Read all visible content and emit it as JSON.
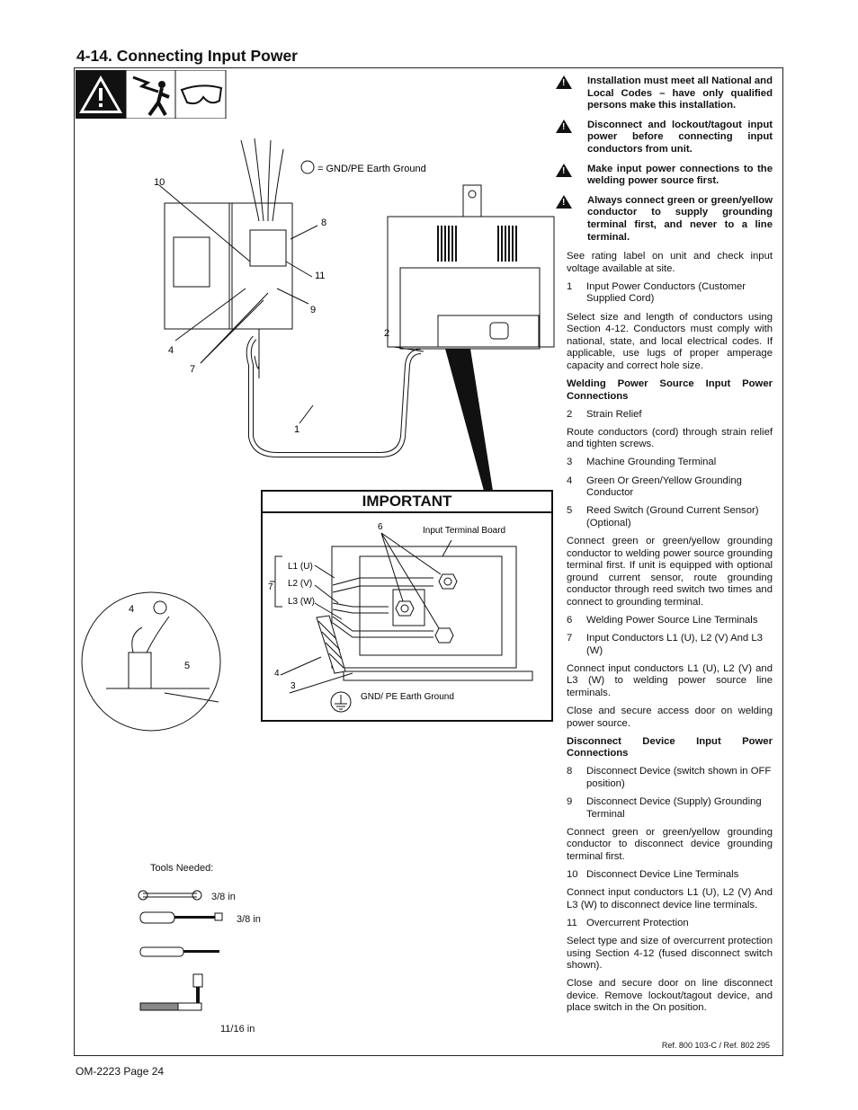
{
  "title": "4-14. Connecting Input Power",
  "footer": "OM-2223 Page 24",
  "reference": "Ref. 800 103-C / Ref. 802 295",
  "safety_icons": [
    "warning-icon",
    "electric-shock-icon",
    "safety-glasses-icon"
  ],
  "warnings": [
    "Installation must meet all National and Local Codes – have only qualified persons make this installation.",
    "Disconnect and lockout/tagout input power before connecting input conductors from unit.",
    "Make input power connections to the welding power source first.",
    "Always connect green or green/yellow conductor to supply grounding terminal first, and never to a line terminal."
  ],
  "body": {
    "p1": "See rating label on unit and check input voltage available at site.",
    "i1": {
      "n": "1",
      "t": "Input Power Conductors (Customer Supplied Cord)"
    },
    "p2": "Select size and length of conductors using Section 4-12. Conductors must comply with national, state, and local electrical codes. If applicable, use lugs of proper amperage capacity and correct hole size.",
    "h1": "Welding Power Source Input Power Connections",
    "i2": {
      "n": "2",
      "t": "Strain Relief"
    },
    "p3": "Route conductors (cord) through strain relief and tighten screws.",
    "i3": {
      "n": "3",
      "t": "Machine Grounding Terminal"
    },
    "i4": {
      "n": "4",
      "t": "Green Or Green/Yellow Grounding Conductor"
    },
    "i5": {
      "n": "5",
      "t": "Reed Switch (Ground Current Sensor) (Optional)"
    },
    "p4": "Connect green or green/yellow grounding conductor to welding power source grounding terminal first. If unit is equipped with optional ground current sensor, route grounding conductor through reed switch two times and connect to grounding terminal.",
    "i6": {
      "n": "6",
      "t": "Welding Power Source Line Terminals"
    },
    "i7": {
      "n": "7",
      "t": "Input Conductors L1 (U), L2 (V) And L3 (W)"
    },
    "p5": "Connect input conductors L1 (U), L2 (V) and L3 (W) to welding power source line terminals.",
    "p6": "Close and secure access door on welding power source.",
    "h2": "Disconnect Device Input Power Connections",
    "i8": {
      "n": "8",
      "t": "Disconnect Device (switch shown in OFF position)"
    },
    "i9": {
      "n": "9",
      "t": "Disconnect Device (Supply) Grounding Terminal"
    },
    "p7": "Connect green or green/yellow grounding conductor to disconnect device grounding terminal first.",
    "i10": {
      "n": "10",
      "t": "Disconnect Device Line Terminals"
    },
    "p8": "Connect input conductors L1 (U), L2 (V) And L3 (W) to disconnect device line terminals.",
    "i11": {
      "n": "11",
      "t": "Overcurrent Protection"
    },
    "p9": "Select type and size of overcurrent protection using Section 4-12 (fused disconnect switch shown).",
    "p10": "Close and secure door on line disconnect device. Remove lockout/tagout device, and place switch in the On position."
  },
  "diagram": {
    "gnd_label": "= GND/PE Earth Ground",
    "callouts": [
      "1",
      "2",
      "4",
      "7",
      "8",
      "9",
      "10",
      "11"
    ],
    "important": "IMPORTANT",
    "input_terminal_board": "Input Terminal Board",
    "l1": "L1 (U)",
    "l2": "L2 (V)",
    "l3": "L3 (W)",
    "c6": "6",
    "c7": "7",
    "c4": "4",
    "c3": "3",
    "c5": "5",
    "c4b": "4",
    "gnd_pe": "GND/ PE  Earth Ground"
  },
  "tools": {
    "label": "Tools Needed:",
    "items": [
      {
        "icon": "wrench-icon",
        "size": "3/8 in"
      },
      {
        "icon": "nut-driver-icon",
        "size": "3/8 in"
      },
      {
        "icon": "screwdriver-icon",
        "size": ""
      },
      {
        "icon": "ratchet-socket-icon",
        "size": "11/16 in"
      }
    ]
  }
}
